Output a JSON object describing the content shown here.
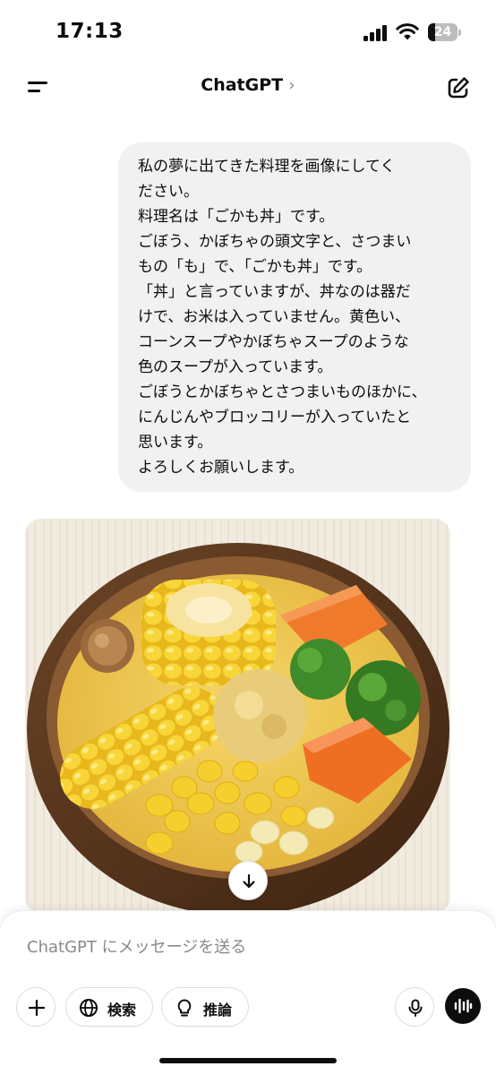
{
  "status_bar": {
    "time": "17:13",
    "battery_percent": "24",
    "battery_level": 0.24,
    "icons": [
      "signal-icon",
      "wifi-icon",
      "battery-icon"
    ]
  },
  "nav": {
    "title": "ChatGPT",
    "chevron": "›",
    "icons": {
      "menu": "menu-icon",
      "compose": "compose-icon"
    }
  },
  "conversation": {
    "user_message_lines": [
      "私の夢に出てきた料理を画像にしてく",
      "ださい。",
      "料理名は「ごかも丼」です。",
      "ごぼう、かぼちゃの頭文字と、さつまい",
      "もの「も」で、「ごかも丼」です。",
      "「丼」と言っていますが、丼なのは器だ",
      "けで、お米は入っていません。黄色い、",
      "コーンスープやかぼちゃスープのような",
      "色のスープが入っています。",
      "ごぼうとかぼちゃとさつまいものほかに、",
      "にんじんやブロッコリーが入っていたと",
      "思います。",
      "よろしくお願いします。"
    ],
    "generated_image": {
      "subject": "bowl of yellow soup with corn, carrot, broccoli and burdock",
      "colors": {
        "soup": "#f2c94c",
        "bowl": "#5a3a22",
        "corn": "#f6cf2a",
        "carrot": "#f07a2c",
        "broccoli": "#3f8a2a"
      }
    },
    "scroll_down_icon": "arrow-down-icon"
  },
  "composer": {
    "placeholder": "ChatGPT にメッセージを送る",
    "buttons": {
      "add_icon": "plus-icon",
      "search_label": "検索",
      "search_icon": "globe-icon",
      "reason_label": "推論",
      "reason_icon": "lightbulb-icon",
      "mic_icon": "microphone-icon",
      "voice_icon": "voice-waveform-icon"
    }
  }
}
